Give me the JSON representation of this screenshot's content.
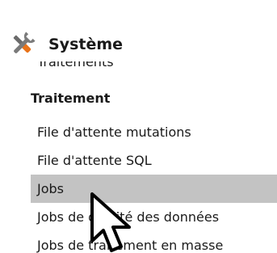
{
  "menu": {
    "title": "Système",
    "header_icon": "tools-icon",
    "partial_item_label": "Traitements",
    "group_title": "Traitement",
    "items": [
      {
        "label": "File d'attente mutations",
        "selected": false
      },
      {
        "label": "File d'attente SQL",
        "selected": false
      },
      {
        "label": "Jobs",
        "selected": true
      },
      {
        "label": "Jobs de qualité des données",
        "selected": false
      },
      {
        "label": "Jobs de traitement en masse",
        "selected": false
      }
    ],
    "selection_color": "#c3c3c3"
  },
  "cursor_icon": "mouse-pointer-icon"
}
